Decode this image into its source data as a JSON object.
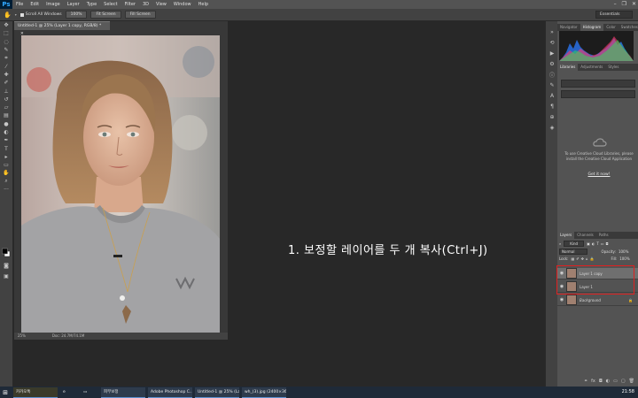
{
  "app": {
    "logo": "Ps"
  },
  "menu": [
    "File",
    "Edit",
    "Image",
    "Layer",
    "Type",
    "Select",
    "Filter",
    "3D",
    "View",
    "Window",
    "Help"
  ],
  "window_controls": {
    "minimize": "–",
    "restore": "❐",
    "close": "✕"
  },
  "options_bar": {
    "scroll_all_windows": "Scroll All Windows",
    "zoom_100": "100%",
    "fit_screen": "Fit Screen",
    "fill_screen": "Fill Screen",
    "workspace": "Essentials"
  },
  "document": {
    "tab_title": "Untitled-1 @ 25% (Layer 1 copy, RGB/8) *",
    "zoom": "25%",
    "doc_size": "Doc: 24.7M/74.1M"
  },
  "annotation": "1. 보정할 레이어를 두 개 복사(Ctrl+J)",
  "panels": {
    "top_tabs": [
      "Navigator",
      "Histogram",
      "Color",
      "Swatches"
    ],
    "top_active": 1,
    "lib_tabs": [
      "Libraries",
      "Adjustments",
      "Styles"
    ],
    "lib_active": 0,
    "cc_message": "To use Creative Cloud Libraries, please install the Creative Cloud Application",
    "cc_link": "Get it now!",
    "layers_tabs": [
      "Layers",
      "Channels",
      "Paths"
    ],
    "layers_active": 0,
    "filter_kind": "Kind",
    "blend_mode": "Normal",
    "opacity_label": "Opacity:",
    "opacity_value": "100%",
    "lock_label": "Lock:",
    "fill_label": "Fill:",
    "fill_value": "100%",
    "layers": [
      {
        "name": "Layer 1 copy",
        "selected": true
      },
      {
        "name": "Layer 1",
        "selected": false
      },
      {
        "name": "Background",
        "selected": false
      }
    ]
  },
  "taskbar": {
    "items": [
      "카카오톡",
      "피부보정",
      "Adobe Photoshop C...",
      "Untitled-1 @ 25% (La...",
      "wh_(3).jpg (2400×36..."
    ],
    "clock": "21:58"
  },
  "colors": {
    "accent": "#31a8ff",
    "highlight_box": "#e02020"
  }
}
